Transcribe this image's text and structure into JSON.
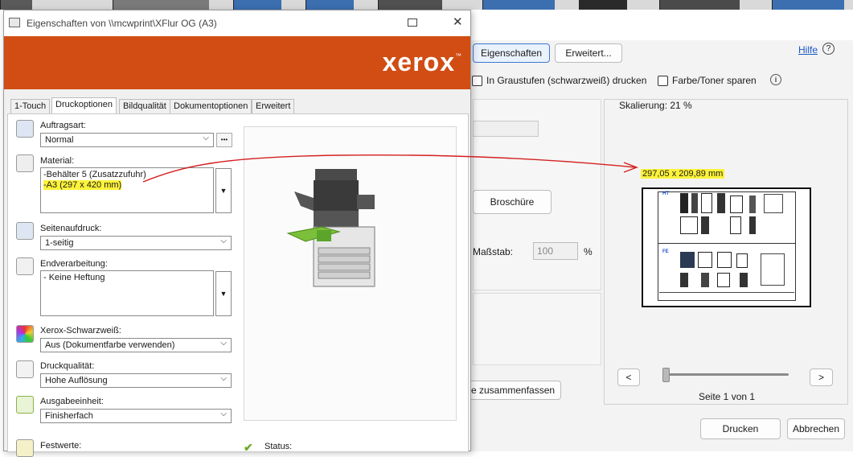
{
  "front_dialog": {
    "title": "Eigenschaften von \\\\mcwprint\\XFlur OG (A3)",
    "brand": "xerox",
    "brand_mark": "™",
    "tabs": [
      {
        "label": "1-Touch"
      },
      {
        "label": "Druckoptionen"
      },
      {
        "label": "Bildqualität"
      },
      {
        "label": "Dokumentoptionen"
      },
      {
        "label": "Erweitert"
      }
    ],
    "auftragsart": {
      "label": "Auftragsart:",
      "value": "Normal",
      "more": "•••"
    },
    "material": {
      "label": "Material:",
      "line1": "-Behälter 5 (Zusatzzufuhr)",
      "line2": "-A3 (297 x 420 mm)"
    },
    "seitenaufdruck": {
      "label": "Seitenaufdruck:",
      "value": "1-seitig"
    },
    "endverarbeitung": {
      "label": "Endverarbeitung:",
      "value": "- Keine Heftung"
    },
    "schwarzweiss": {
      "label": "Xerox-Schwarzweiß:",
      "value": "Aus (Dokumentfarbe verwenden)"
    },
    "druckqualitaet": {
      "label": "Druckqualität:",
      "value": "Hohe Auflösung"
    },
    "ausgabeeinheit": {
      "label": "Ausgabeeinheit:",
      "value": "Finisherfach"
    },
    "festwerte": {
      "label": "Festwerte:"
    },
    "status": {
      "label": "Status:"
    }
  },
  "back_dialog": {
    "eigenschaften_button": "Eigenschaften",
    "erweitert_button": "Erweitert...",
    "hilfe_link": "Hilfe",
    "graustufen": "In Graustufen (schwarzweiß) drucken",
    "toner_sparen": "Farbe/Toner sparen",
    "skalierung": "Skalierung:  21 %",
    "paper_size": "297,05 x 209,89 mm",
    "broschuere_button": "Broschüre",
    "massstab_label": "Maßstab:",
    "massstab_value": "100",
    "percent": "%",
    "zusammenfassen_button": "re zusammenfassen",
    "prev": "<",
    "next": ">",
    "page_indicator": "Seite 1 von 1",
    "drucken_button": "Drucken",
    "abbrechen_button": "Abbrechen",
    "preview_labels": {
      "top": "HT",
      "bottom": "FE"
    },
    "slider_position": 0
  },
  "colors": {
    "xerox_orange": "#d14d13",
    "highlight": "#fcf33a",
    "annotation_red": "#d42020",
    "accent_blue": "#3b7ad6"
  }
}
